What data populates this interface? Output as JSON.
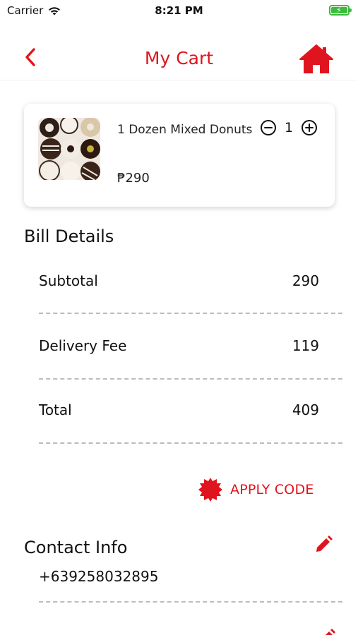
{
  "status_bar": {
    "carrier": "Carrier",
    "time": "8:21 PM"
  },
  "header": {
    "title": "My Cart"
  },
  "cart_item": {
    "name": "1 Dozen Mixed Donuts",
    "price": "₱290",
    "quantity": "1"
  },
  "bill": {
    "title": "Bill Details",
    "rows": [
      {
        "label": "Subtotal",
        "value": "290"
      },
      {
        "label": "Delivery Fee",
        "value": "119"
      },
      {
        "label": "Total",
        "value": "409"
      }
    ]
  },
  "apply_code": {
    "label": "APPLY CODE"
  },
  "contact": {
    "title": "Contact Info",
    "phone": "+639258032895"
  },
  "colors": {
    "accent": "#e0141e",
    "battery": "#3dbb3d"
  },
  "icons": [
    "wifi-icon",
    "battery-icon",
    "back-icon",
    "home-icon",
    "minus-circle-icon",
    "plus-circle-icon",
    "badge-icon",
    "edit-icon"
  ]
}
